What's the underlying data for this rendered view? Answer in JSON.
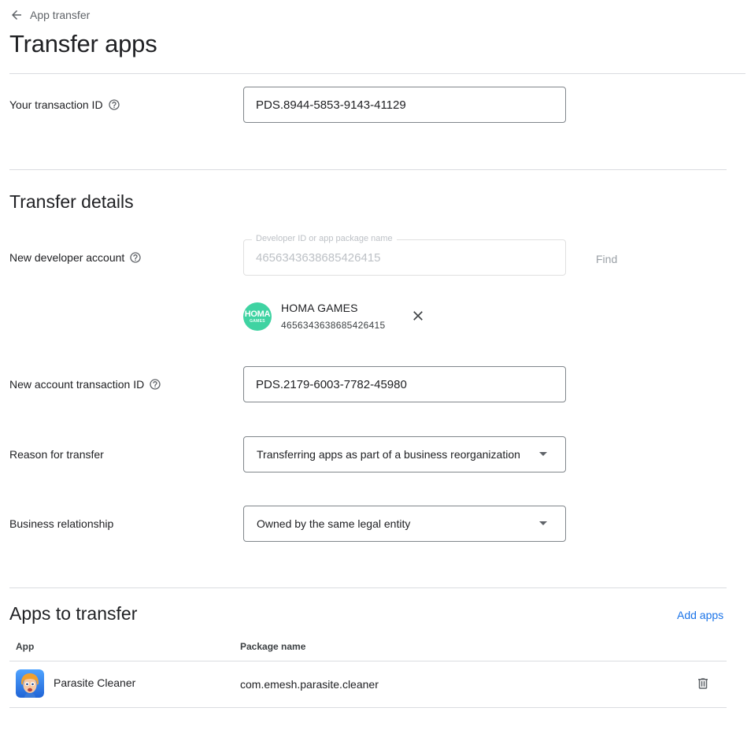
{
  "breadcrumb": {
    "label": "App transfer"
  },
  "page": {
    "title": "Transfer apps"
  },
  "transaction": {
    "label": "Your transaction ID",
    "value": "PDS.8944-5853-9143-41129"
  },
  "transfer_details": {
    "title": "Transfer details",
    "new_developer": {
      "label": "New developer account",
      "field_label": "Developer ID or app package name",
      "field_value": "4656343638685426415",
      "find_label": "Find",
      "selected": {
        "logo_text": "HOMA",
        "logo_subtext": "GAMES",
        "name": "HOMA GAMES",
        "id": "4656343638685426415"
      }
    },
    "new_account_transaction": {
      "label": "New account transaction ID",
      "value": "PDS.2179-6003-7782-45980"
    },
    "reason": {
      "label": "Reason for transfer",
      "value": "Transferring apps as part of a business reorganization"
    },
    "relationship": {
      "label": "Business relationship",
      "value": "Owned by the same legal entity"
    }
  },
  "apps_to_transfer": {
    "title": "Apps to transfer",
    "add_label": "Add apps",
    "columns": [
      "App",
      "Package name"
    ],
    "rows": [
      {
        "app": "Parasite Cleaner",
        "package": "com.emesh.parasite.cleaner"
      }
    ]
  },
  "colors": {
    "link": "#1a73e8",
    "homa_logo": "#3fd3a2",
    "divider": "#dadce0",
    "border": "#80868b"
  }
}
